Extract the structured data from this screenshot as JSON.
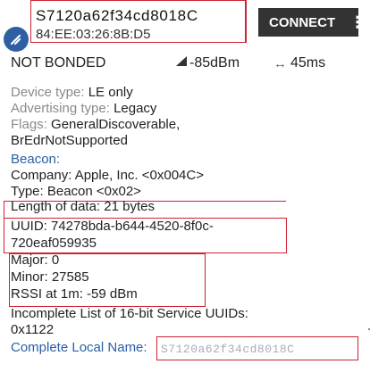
{
  "device": {
    "name": "S7120a62f34cd8018C",
    "mac": "84:EE:03:26:8B:D5",
    "connect_label": "CONNECT",
    "menu_icon": "vertical-dots-icon"
  },
  "status": {
    "bond": "NOT BONDED",
    "rssi": "-85dBm",
    "interval": "45ms",
    "signal_icon": "signal-icon",
    "interval_icon": "arrows-icon"
  },
  "details": {
    "device_type_label": "Device type:",
    "device_type_value": "LE only",
    "advertising_label": "Advertising type:",
    "advertising_value": "Legacy",
    "flags_label": "Flags:",
    "flags_value": "GeneralDiscoverable,",
    "flags_value2": "BrEdrNotSupported"
  },
  "beacon": {
    "label": "Beacon:",
    "company": "Company: Apple, Inc. <0x004C>",
    "type": "Type: Beacon <0x02>",
    "length": "Length of data: 21 bytes",
    "uuid_line1": "UUID: 74278bda-b644-4520-8f0c-",
    "uuid_line2": "720eaf059935",
    "major": "Major: 0",
    "minor": "Minor: 27585",
    "rssi_1m": "RSSI at 1m: -59 dBm"
  },
  "services": {
    "label": "Incomplete List of 16-bit Service UUIDs:",
    "value": "0x1122"
  },
  "local_name": {
    "label": "Complete Local Name:",
    "value": "S7120a62f34cd8018C"
  },
  "colors": {
    "accent": "#2f5fa3",
    "highlight_box": "#cc2233",
    "button": "#333333"
  }
}
